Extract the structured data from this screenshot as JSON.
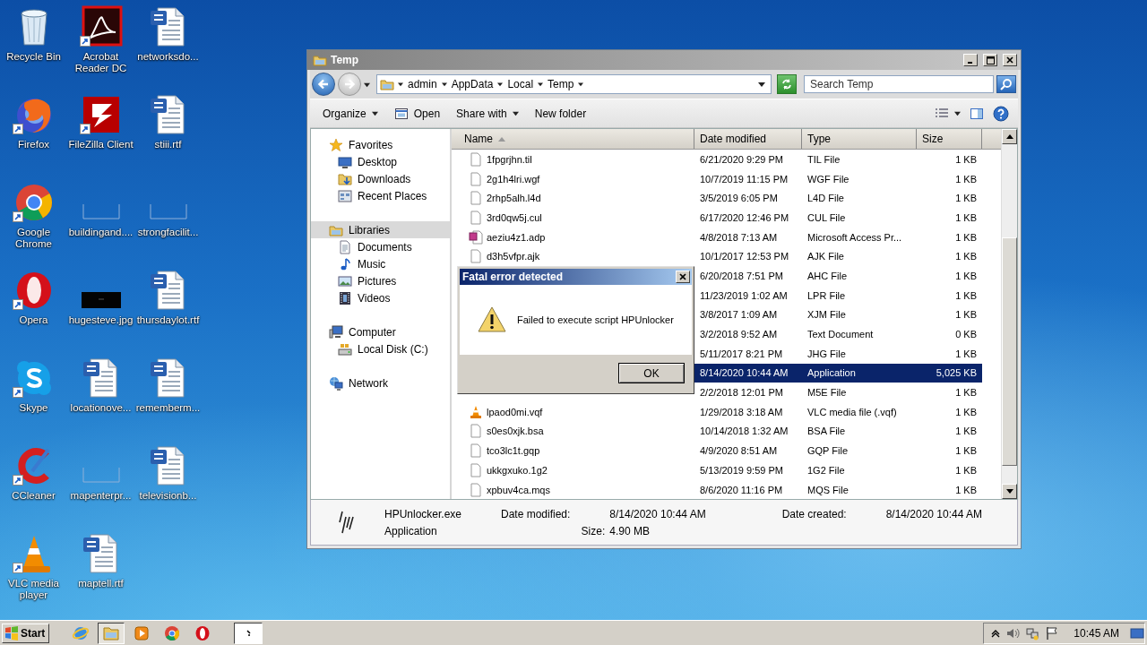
{
  "desktop_icons": [
    {
      "label": "Recycle Bin",
      "kind": "recycle",
      "shortcut": false
    },
    {
      "label": "Firefox",
      "kind": "firefox",
      "shortcut": true
    },
    {
      "label": "Google Chrome",
      "kind": "chrome",
      "shortcut": true
    },
    {
      "label": "Opera",
      "kind": "opera",
      "shortcut": true
    },
    {
      "label": "Skype",
      "kind": "skype",
      "shortcut": true
    },
    {
      "label": "CCleaner",
      "kind": "ccleaner",
      "shortcut": true
    },
    {
      "label": "VLC media player",
      "kind": "vlc",
      "shortcut": true
    },
    {
      "label": "Acrobat Reader DC",
      "kind": "acrobat",
      "shortcut": true
    },
    {
      "label": "FileZilla Client",
      "kind": "filezilla",
      "shortcut": true
    },
    {
      "label": "buildingand....",
      "kind": "thumb",
      "shortcut": false
    },
    {
      "label": "hugesteve.jpg",
      "kind": "dark",
      "shortcut": false
    },
    {
      "label": "locationove...",
      "kind": "word",
      "shortcut": false
    },
    {
      "label": "mapenterpr...",
      "kind": "thumb",
      "shortcut": false
    },
    {
      "label": "maptell.rtf",
      "kind": "word",
      "shortcut": false
    },
    {
      "label": "networksdo...",
      "kind": "word",
      "shortcut": false
    },
    {
      "label": "stiii.rtf",
      "kind": "word",
      "shortcut": false
    },
    {
      "label": "strongfacilit...",
      "kind": "thumb",
      "shortcut": false
    },
    {
      "label": "thursdaylot.rtf",
      "kind": "word",
      "shortcut": false
    },
    {
      "label": "rememberm...",
      "kind": "word",
      "shortcut": false
    },
    {
      "label": "televisionb...",
      "kind": "word",
      "shortcut": false
    }
  ],
  "explorer": {
    "title": "Temp",
    "breadcrumb": [
      "admin",
      "AppData",
      "Local",
      "Temp"
    ],
    "search": {
      "placeholder": "Search Temp"
    },
    "toolbar": [
      {
        "label": "Organize",
        "kind": "menu"
      },
      {
        "label": "Open",
        "kind": "open"
      },
      {
        "label": "Share with",
        "kind": "menu"
      },
      {
        "label": "New folder",
        "kind": "plain"
      }
    ],
    "nav": [
      {
        "label": "Favorites",
        "kind": "star",
        "selected": false,
        "children": [
          {
            "label": "Desktop",
            "kind": "desktop",
            "selected": false
          },
          {
            "label": "Downloads",
            "kind": "downloads",
            "selected": false
          },
          {
            "label": "Recent Places",
            "kind": "recent",
            "selected": false
          }
        ]
      },
      {
        "label": "Libraries",
        "kind": "libraries",
        "selected": true,
        "children": [
          {
            "label": "Documents",
            "kind": "documents",
            "selected": false
          },
          {
            "label": "Music",
            "kind": "music",
            "selected": false
          },
          {
            "label": "Pictures",
            "kind": "pictures",
            "selected": false
          },
          {
            "label": "Videos",
            "kind": "videos",
            "selected": false
          }
        ]
      },
      {
        "label": "Computer",
        "kind": "computer",
        "selected": false,
        "children": [
          {
            "label": "Local Disk (C:)",
            "kind": "disk",
            "selected": false
          }
        ]
      },
      {
        "label": "Network",
        "kind": "network",
        "selected": false
      }
    ],
    "columns": [
      {
        "label": "Name",
        "sorted": true
      },
      {
        "label": "Date modified",
        "sorted": false
      },
      {
        "label": "Type",
        "sorted": false
      },
      {
        "label": "Size",
        "sorted": false
      }
    ],
    "rows": [
      {
        "name": "1fpgrjhn.til",
        "kind": "blank",
        "date": "6/21/2020 9:29 PM",
        "type": "TIL File",
        "size": "1 KB",
        "selected": false
      },
      {
        "name": "2g1h4lri.wgf",
        "kind": "blank",
        "date": "10/7/2019 11:15 PM",
        "type": "WGF File",
        "size": "1 KB",
        "selected": false
      },
      {
        "name": "2rhp5alh.l4d",
        "kind": "blank",
        "date": "3/5/2019 6:05 PM",
        "type": "L4D File",
        "size": "1 KB",
        "selected": false
      },
      {
        "name": "3rd0qw5j.cul",
        "kind": "blank",
        "date": "6/17/2020 12:46 PM",
        "type": "CUL File",
        "size": "1 KB",
        "selected": false
      },
      {
        "name": "aeziu4z1.adp",
        "kind": "access",
        "date": "4/8/2018 7:13 AM",
        "type": "Microsoft Access Pr...",
        "size": "1 KB",
        "selected": false
      },
      {
        "name": "d3h5vfpr.ajk",
        "kind": "blank",
        "date": "10/1/2017 12:53 PM",
        "type": "AJK File",
        "size": "1 KB",
        "selected": false
      },
      {
        "date": "6/20/2018 7:51 PM",
        "type": "AHC File",
        "size": "1 KB",
        "selected": false
      },
      {
        "date": "11/23/2019 1:02 AM",
        "type": "LPR File",
        "size": "1 KB",
        "selected": false
      },
      {
        "date": "3/8/2017 1:09 AM",
        "type": "XJM File",
        "size": "1 KB",
        "selected": false
      },
      {
        "date": "3/2/2018 9:52 AM",
        "type": "Text Document",
        "size": "0 KB",
        "selected": false
      },
      {
        "date": "5/11/2017 8:21 PM",
        "type": "JHG File",
        "size": "1 KB",
        "selected": false
      },
      {
        "date": "8/14/2020 10:44 AM",
        "type": "Application",
        "size": "5,025 KB",
        "selected": true
      },
      {
        "date": "2/2/2018 12:01 PM",
        "type": "M5E File",
        "size": "1 KB",
        "selected": false
      },
      {
        "name": "lpaod0mi.vqf",
        "kind": "vlc",
        "date": "1/29/2018 3:18 AM",
        "type": "VLC media file (.vqf)",
        "size": "1 KB",
        "selected": false
      },
      {
        "name": "s0es0xjk.bsa",
        "kind": "blank",
        "date": "10/14/2018 1:32 AM",
        "type": "BSA File",
        "size": "1 KB",
        "selected": false
      },
      {
        "name": "tco3lc1t.gqp",
        "kind": "blank",
        "date": "4/9/2020 8:51 AM",
        "type": "GQP File",
        "size": "1 KB",
        "selected": false
      },
      {
        "name": "ukkgxuko.1g2",
        "kind": "blank",
        "date": "5/13/2019 9:59 PM",
        "type": "1G2 File",
        "size": "1 KB",
        "selected": false
      },
      {
        "name": "xpbuv4ca.mqs",
        "kind": "blank",
        "date": "8/6/2020 11:16 PM",
        "type": "MQS File",
        "size": "1 KB",
        "selected": false
      }
    ],
    "details": {
      "name": "HPUnlocker.exe",
      "type": "Application",
      "modified_label": "Date modified:",
      "modified": "8/14/2020 10:44 AM",
      "size_label": "Size:",
      "size": "4.90 MB",
      "created_label": "Date created:",
      "created": "8/14/2020 10:44 AM"
    }
  },
  "dialog": {
    "title": "Fatal error detected",
    "message": "Failed to execute script HPUnlocker",
    "button": "OK"
  },
  "taskbar": {
    "start": "Start",
    "apps": [
      {
        "kind": "ie",
        "active": false
      },
      {
        "kind": "folder",
        "active": true
      },
      {
        "kind": "media",
        "active": false
      },
      {
        "kind": "chrome",
        "active": false
      },
      {
        "kind": "opera",
        "active": false
      },
      {
        "kind": "window",
        "active": true
      }
    ],
    "clock": "10:45 AM"
  }
}
